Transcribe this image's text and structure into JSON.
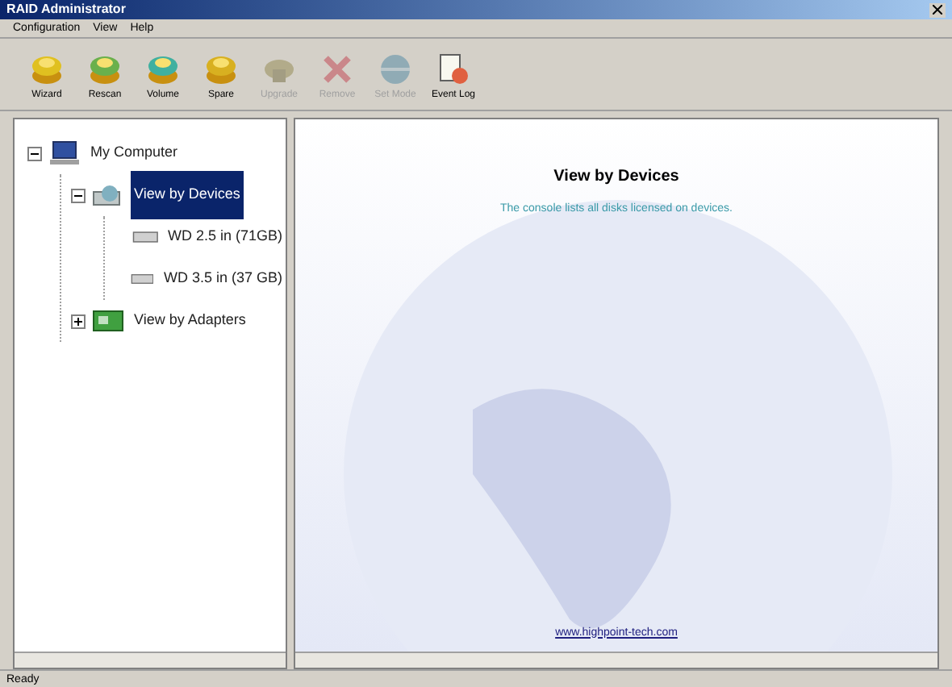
{
  "window": {
    "title": "RAID Administrator"
  },
  "menu": [
    "Configuration",
    "View",
    "Help"
  ],
  "toolbar": [
    {
      "label": "Wizard",
      "kind": "wizard",
      "disabled": false
    },
    {
      "label": "Rescan",
      "kind": "rescan",
      "disabled": false
    },
    {
      "label": "Volume",
      "kind": "volume",
      "disabled": false
    },
    {
      "label": "Spare",
      "kind": "spare",
      "disabled": false
    },
    {
      "label": "Upgrade",
      "kind": "upgrade",
      "disabled": true
    },
    {
      "label": "Remove",
      "kind": "remove",
      "disabled": true
    },
    {
      "label": "Set Mode",
      "kind": "mode",
      "disabled": true
    },
    {
      "label": "Event Log",
      "kind": "log",
      "disabled": false
    }
  ],
  "tree": [
    {
      "label": "My Computer",
      "kind": "computer",
      "expanded": true,
      "selected": false,
      "children": [
        {
          "label": "View by Devices",
          "kind": "devices",
          "expanded": true,
          "selected": true,
          "children": [
            {
              "label": "WD 2.5 in (71GB)",
              "kind": "disk",
              "selected": false
            },
            {
              "label": "WD 3.5 in (37 GB)",
              "kind": "disk",
              "selected": false
            }
          ]
        },
        {
          "label": "View by Adapters",
          "kind": "adapters",
          "expanded": false,
          "selected": false
        }
      ]
    }
  ],
  "content": {
    "title": "View by Devices",
    "description": "The console lists all disks licensed on devices.",
    "link": "www.highpoint-tech.com"
  },
  "status_bar": "Ready"
}
